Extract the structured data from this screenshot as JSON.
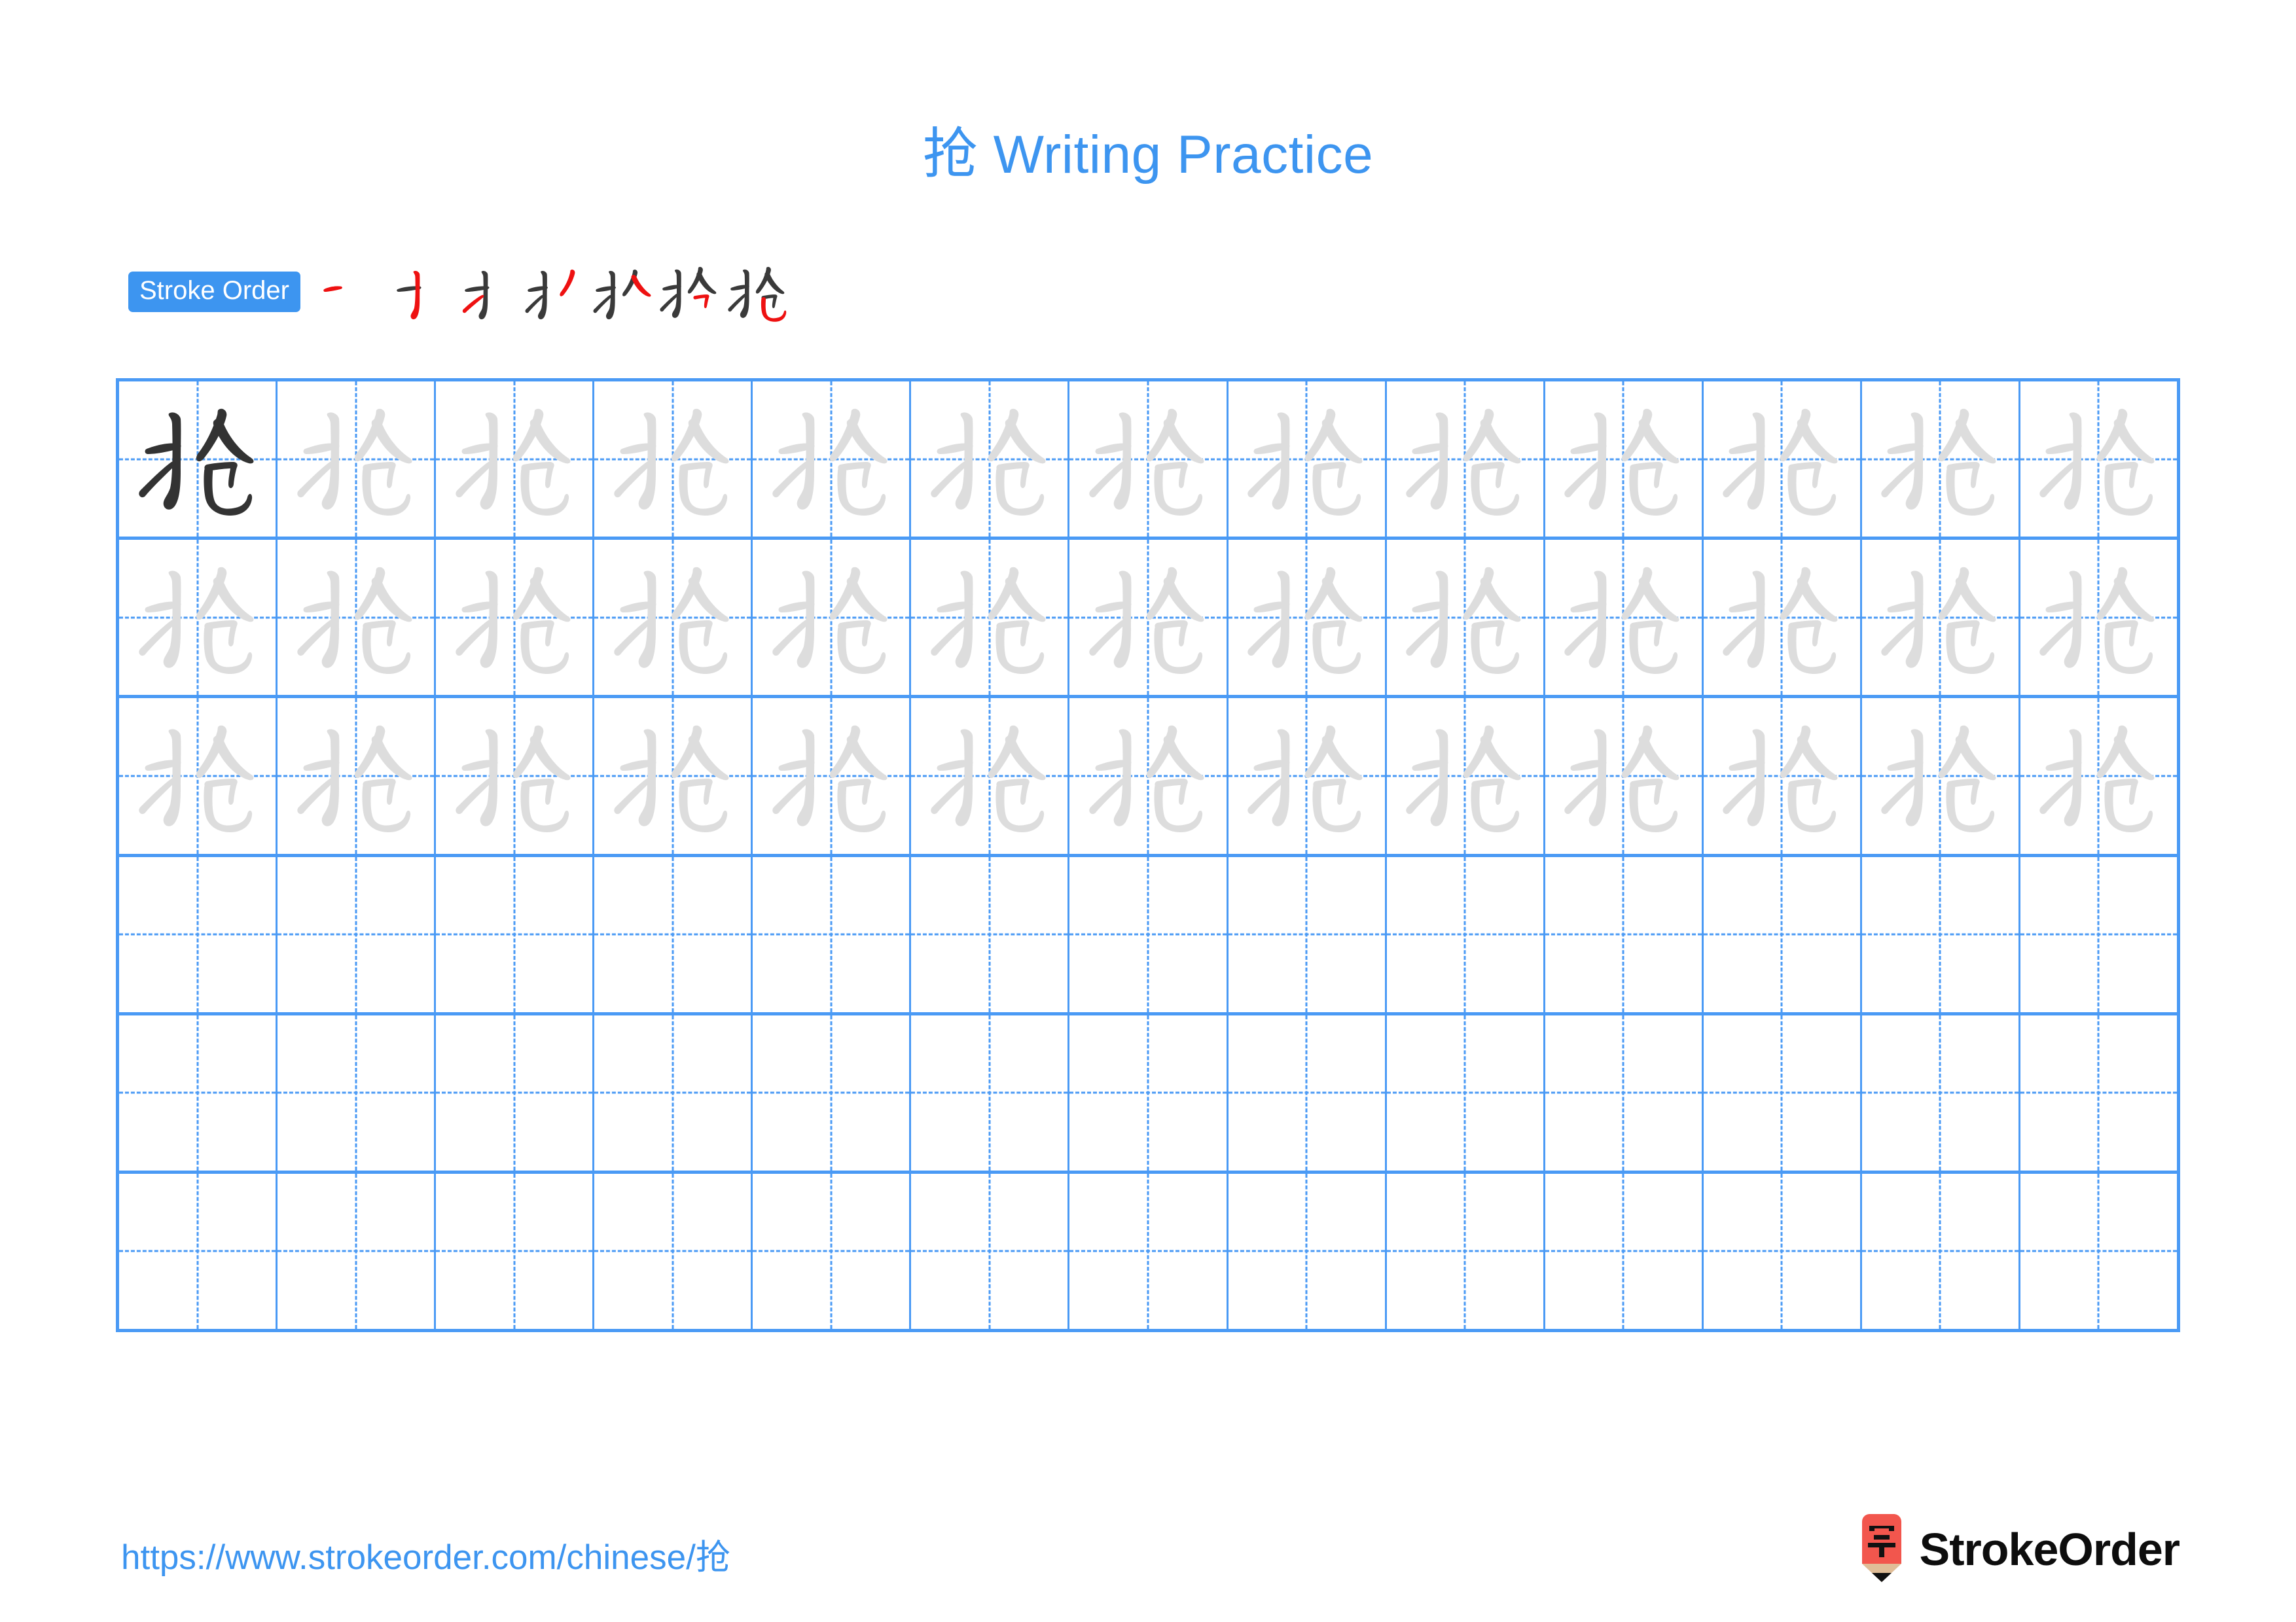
{
  "character": "抢",
  "title": {
    "character": "抢",
    "text": " Writing Practice",
    "full": "抢 Writing Practice",
    "color": "#3d95f0"
  },
  "stroke_order": {
    "badge_label": "Stroke Order",
    "badge_bg": "#3d95f0",
    "badge_color": "#ffffff",
    "stroke_count": 7,
    "new_stroke_color": "#ee1111",
    "existing_stroke_color": "#3a3a3a",
    "steps": [
      {
        "index": 1,
        "name": "stroke-step-1",
        "strokes_shown": 1,
        "new_stroke": "héng (horizontal)"
      },
      {
        "index": 2,
        "name": "stroke-step-2",
        "strokes_shown": 2,
        "new_stroke": "shù gōu (vertical hook)"
      },
      {
        "index": 3,
        "name": "stroke-step-3",
        "strokes_shown": 3,
        "new_stroke": "tí (rising)"
      },
      {
        "index": 4,
        "name": "stroke-step-4",
        "strokes_shown": 4,
        "new_stroke": "piě (left falling)"
      },
      {
        "index": 5,
        "name": "stroke-step-5",
        "strokes_shown": 5,
        "new_stroke": "nà (right falling)"
      },
      {
        "index": 6,
        "name": "stroke-step-6",
        "strokes_shown": 6,
        "new_stroke": "héng zhé (horizontal turn)"
      },
      {
        "index": 7,
        "name": "stroke-step-7",
        "strokes_shown": 7,
        "new_stroke": "shù wān gōu (vertical bend hook)"
      }
    ]
  },
  "grid": {
    "columns": 13,
    "rows": 6,
    "line_color": "#4a9af5",
    "dark_glyph_color": "#333333",
    "light_glyph_color": "#dddddd",
    "rows_data": [
      {
        "index": 0,
        "cells": [
          {
            "char": "抢",
            "shade": "dark"
          },
          {
            "char": "抢",
            "shade": "light"
          },
          {
            "char": "抢",
            "shade": "light"
          },
          {
            "char": "抢",
            "shade": "light"
          },
          {
            "char": "抢",
            "shade": "light"
          },
          {
            "char": "抢",
            "shade": "light"
          },
          {
            "char": "抢",
            "shade": "light"
          },
          {
            "char": "抢",
            "shade": "light"
          },
          {
            "char": "抢",
            "shade": "light"
          },
          {
            "char": "抢",
            "shade": "light"
          },
          {
            "char": "抢",
            "shade": "light"
          },
          {
            "char": "抢",
            "shade": "light"
          },
          {
            "char": "抢",
            "shade": "light"
          }
        ]
      },
      {
        "index": 1,
        "cells": [
          {
            "char": "抢",
            "shade": "light"
          },
          {
            "char": "抢",
            "shade": "light"
          },
          {
            "char": "抢",
            "shade": "light"
          },
          {
            "char": "抢",
            "shade": "light"
          },
          {
            "char": "抢",
            "shade": "light"
          },
          {
            "char": "抢",
            "shade": "light"
          },
          {
            "char": "抢",
            "shade": "light"
          },
          {
            "char": "抢",
            "shade": "light"
          },
          {
            "char": "抢",
            "shade": "light"
          },
          {
            "char": "抢",
            "shade": "light"
          },
          {
            "char": "抢",
            "shade": "light"
          },
          {
            "char": "抢",
            "shade": "light"
          },
          {
            "char": "抢",
            "shade": "light"
          }
        ]
      },
      {
        "index": 2,
        "cells": [
          {
            "char": "抢",
            "shade": "light"
          },
          {
            "char": "抢",
            "shade": "light"
          },
          {
            "char": "抢",
            "shade": "light"
          },
          {
            "char": "抢",
            "shade": "light"
          },
          {
            "char": "抢",
            "shade": "light"
          },
          {
            "char": "抢",
            "shade": "light"
          },
          {
            "char": "抢",
            "shade": "light"
          },
          {
            "char": "抢",
            "shade": "light"
          },
          {
            "char": "抢",
            "shade": "light"
          },
          {
            "char": "抢",
            "shade": "light"
          },
          {
            "char": "抢",
            "shade": "light"
          },
          {
            "char": "抢",
            "shade": "light"
          },
          {
            "char": "抢",
            "shade": "light"
          }
        ]
      },
      {
        "index": 3,
        "cells": [
          {
            "char": "",
            "shade": "empty"
          },
          {
            "char": "",
            "shade": "empty"
          },
          {
            "char": "",
            "shade": "empty"
          },
          {
            "char": "",
            "shade": "empty"
          },
          {
            "char": "",
            "shade": "empty"
          },
          {
            "char": "",
            "shade": "empty"
          },
          {
            "char": "",
            "shade": "empty"
          },
          {
            "char": "",
            "shade": "empty"
          },
          {
            "char": "",
            "shade": "empty"
          },
          {
            "char": "",
            "shade": "empty"
          },
          {
            "char": "",
            "shade": "empty"
          },
          {
            "char": "",
            "shade": "empty"
          },
          {
            "char": "",
            "shade": "empty"
          }
        ]
      },
      {
        "index": 4,
        "cells": [
          {
            "char": "",
            "shade": "empty"
          },
          {
            "char": "",
            "shade": "empty"
          },
          {
            "char": "",
            "shade": "empty"
          },
          {
            "char": "",
            "shade": "empty"
          },
          {
            "char": "",
            "shade": "empty"
          },
          {
            "char": "",
            "shade": "empty"
          },
          {
            "char": "",
            "shade": "empty"
          },
          {
            "char": "",
            "shade": "empty"
          },
          {
            "char": "",
            "shade": "empty"
          },
          {
            "char": "",
            "shade": "empty"
          },
          {
            "char": "",
            "shade": "empty"
          },
          {
            "char": "",
            "shade": "empty"
          },
          {
            "char": "",
            "shade": "empty"
          }
        ]
      },
      {
        "index": 5,
        "cells": [
          {
            "char": "",
            "shade": "empty"
          },
          {
            "char": "",
            "shade": "empty"
          },
          {
            "char": "",
            "shade": "empty"
          },
          {
            "char": "",
            "shade": "empty"
          },
          {
            "char": "",
            "shade": "empty"
          },
          {
            "char": "",
            "shade": "empty"
          },
          {
            "char": "",
            "shade": "empty"
          },
          {
            "char": "",
            "shade": "empty"
          },
          {
            "char": "",
            "shade": "empty"
          },
          {
            "char": "",
            "shade": "empty"
          },
          {
            "char": "",
            "shade": "empty"
          },
          {
            "char": "",
            "shade": "empty"
          },
          {
            "char": "",
            "shade": "empty"
          }
        ]
      }
    ]
  },
  "footer": {
    "url": "https://www.strokeorder.com/chinese/抢",
    "url_color": "#3d95f0",
    "logo_text": "StrokeOrder",
    "logo_icon_char": "字",
    "logo_red": "#f2564d",
    "logo_tan": "#e0bd97",
    "logo_tip": "#111111"
  }
}
